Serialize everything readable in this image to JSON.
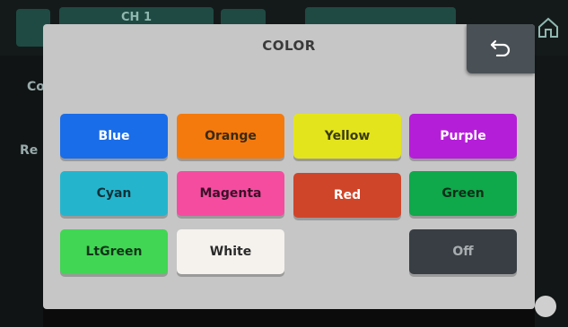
{
  "background": {
    "channel_label": "CH 1",
    "side_labels": [
      "Co",
      "Re"
    ]
  },
  "modal": {
    "title": "COLOR",
    "back_icon": "undo-arrow-icon"
  },
  "colors": [
    {
      "label": "Blue",
      "bg": "#1a6de8",
      "fg": "#ffffff"
    },
    {
      "label": "Orange",
      "bg": "#f57a0d",
      "fg": "#3a2a12"
    },
    {
      "label": "Yellow",
      "bg": "#e3e41c",
      "fg": "#3a3a10"
    },
    {
      "label": "Purple",
      "bg": "#b51ed9",
      "fg": "#ffffff"
    },
    {
      "label": "Cyan",
      "bg": "#24b5cd",
      "fg": "#12323a"
    },
    {
      "label": "Magenta",
      "bg": "#f54ca0",
      "fg": "#3a1228"
    },
    {
      "label": "Red",
      "bg": "#cf452a",
      "fg": "#ffffff"
    },
    {
      "label": "Green",
      "bg": "#0fa84a",
      "fg": "#0f2e1a"
    },
    {
      "label": "LtGreen",
      "bg": "#41d653",
      "fg": "#12341a"
    },
    {
      "label": "White",
      "bg": "#f5f2ee",
      "fg": "#2a2a2a"
    },
    {
      "label": "Off",
      "bg": "#383e44",
      "fg": "#a8adb1"
    }
  ]
}
